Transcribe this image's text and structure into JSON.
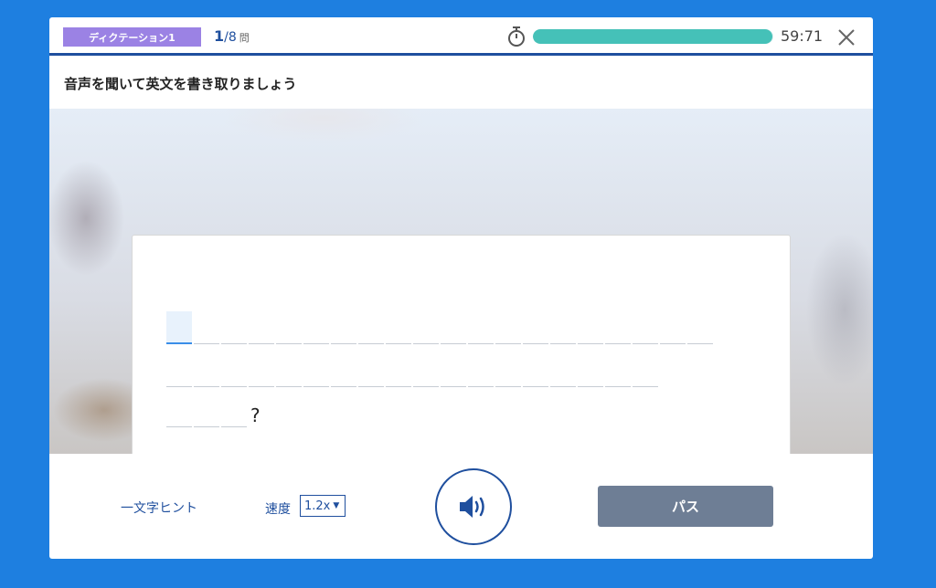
{
  "header": {
    "exercise_badge": "ディクテーション1",
    "question_current": "1",
    "question_total": "/8",
    "question_unit": "問",
    "timer_icon": "stopwatch-icon",
    "timer_progress": 0.995,
    "timer_text": "59:71",
    "close_icon": "close-icon"
  },
  "instruction": "音声を聞いて英文を書き取りましょう",
  "answer": {
    "line1_slots": 20,
    "line2_slots": 18,
    "line3_slots": 3,
    "line3_punctuation": "?"
  },
  "controls": {
    "hint_label": "一文字ヒント",
    "speed_label": "速度",
    "speed_value": "1.2x",
    "audio_icon": "speaker-icon",
    "pass_label": "パス"
  },
  "colors": {
    "background": "#1e7fe0",
    "badge": "#9b82e4",
    "accent": "#1f4f9e",
    "progress": "#45c1b8",
    "pass_button": "#6e7e95"
  }
}
